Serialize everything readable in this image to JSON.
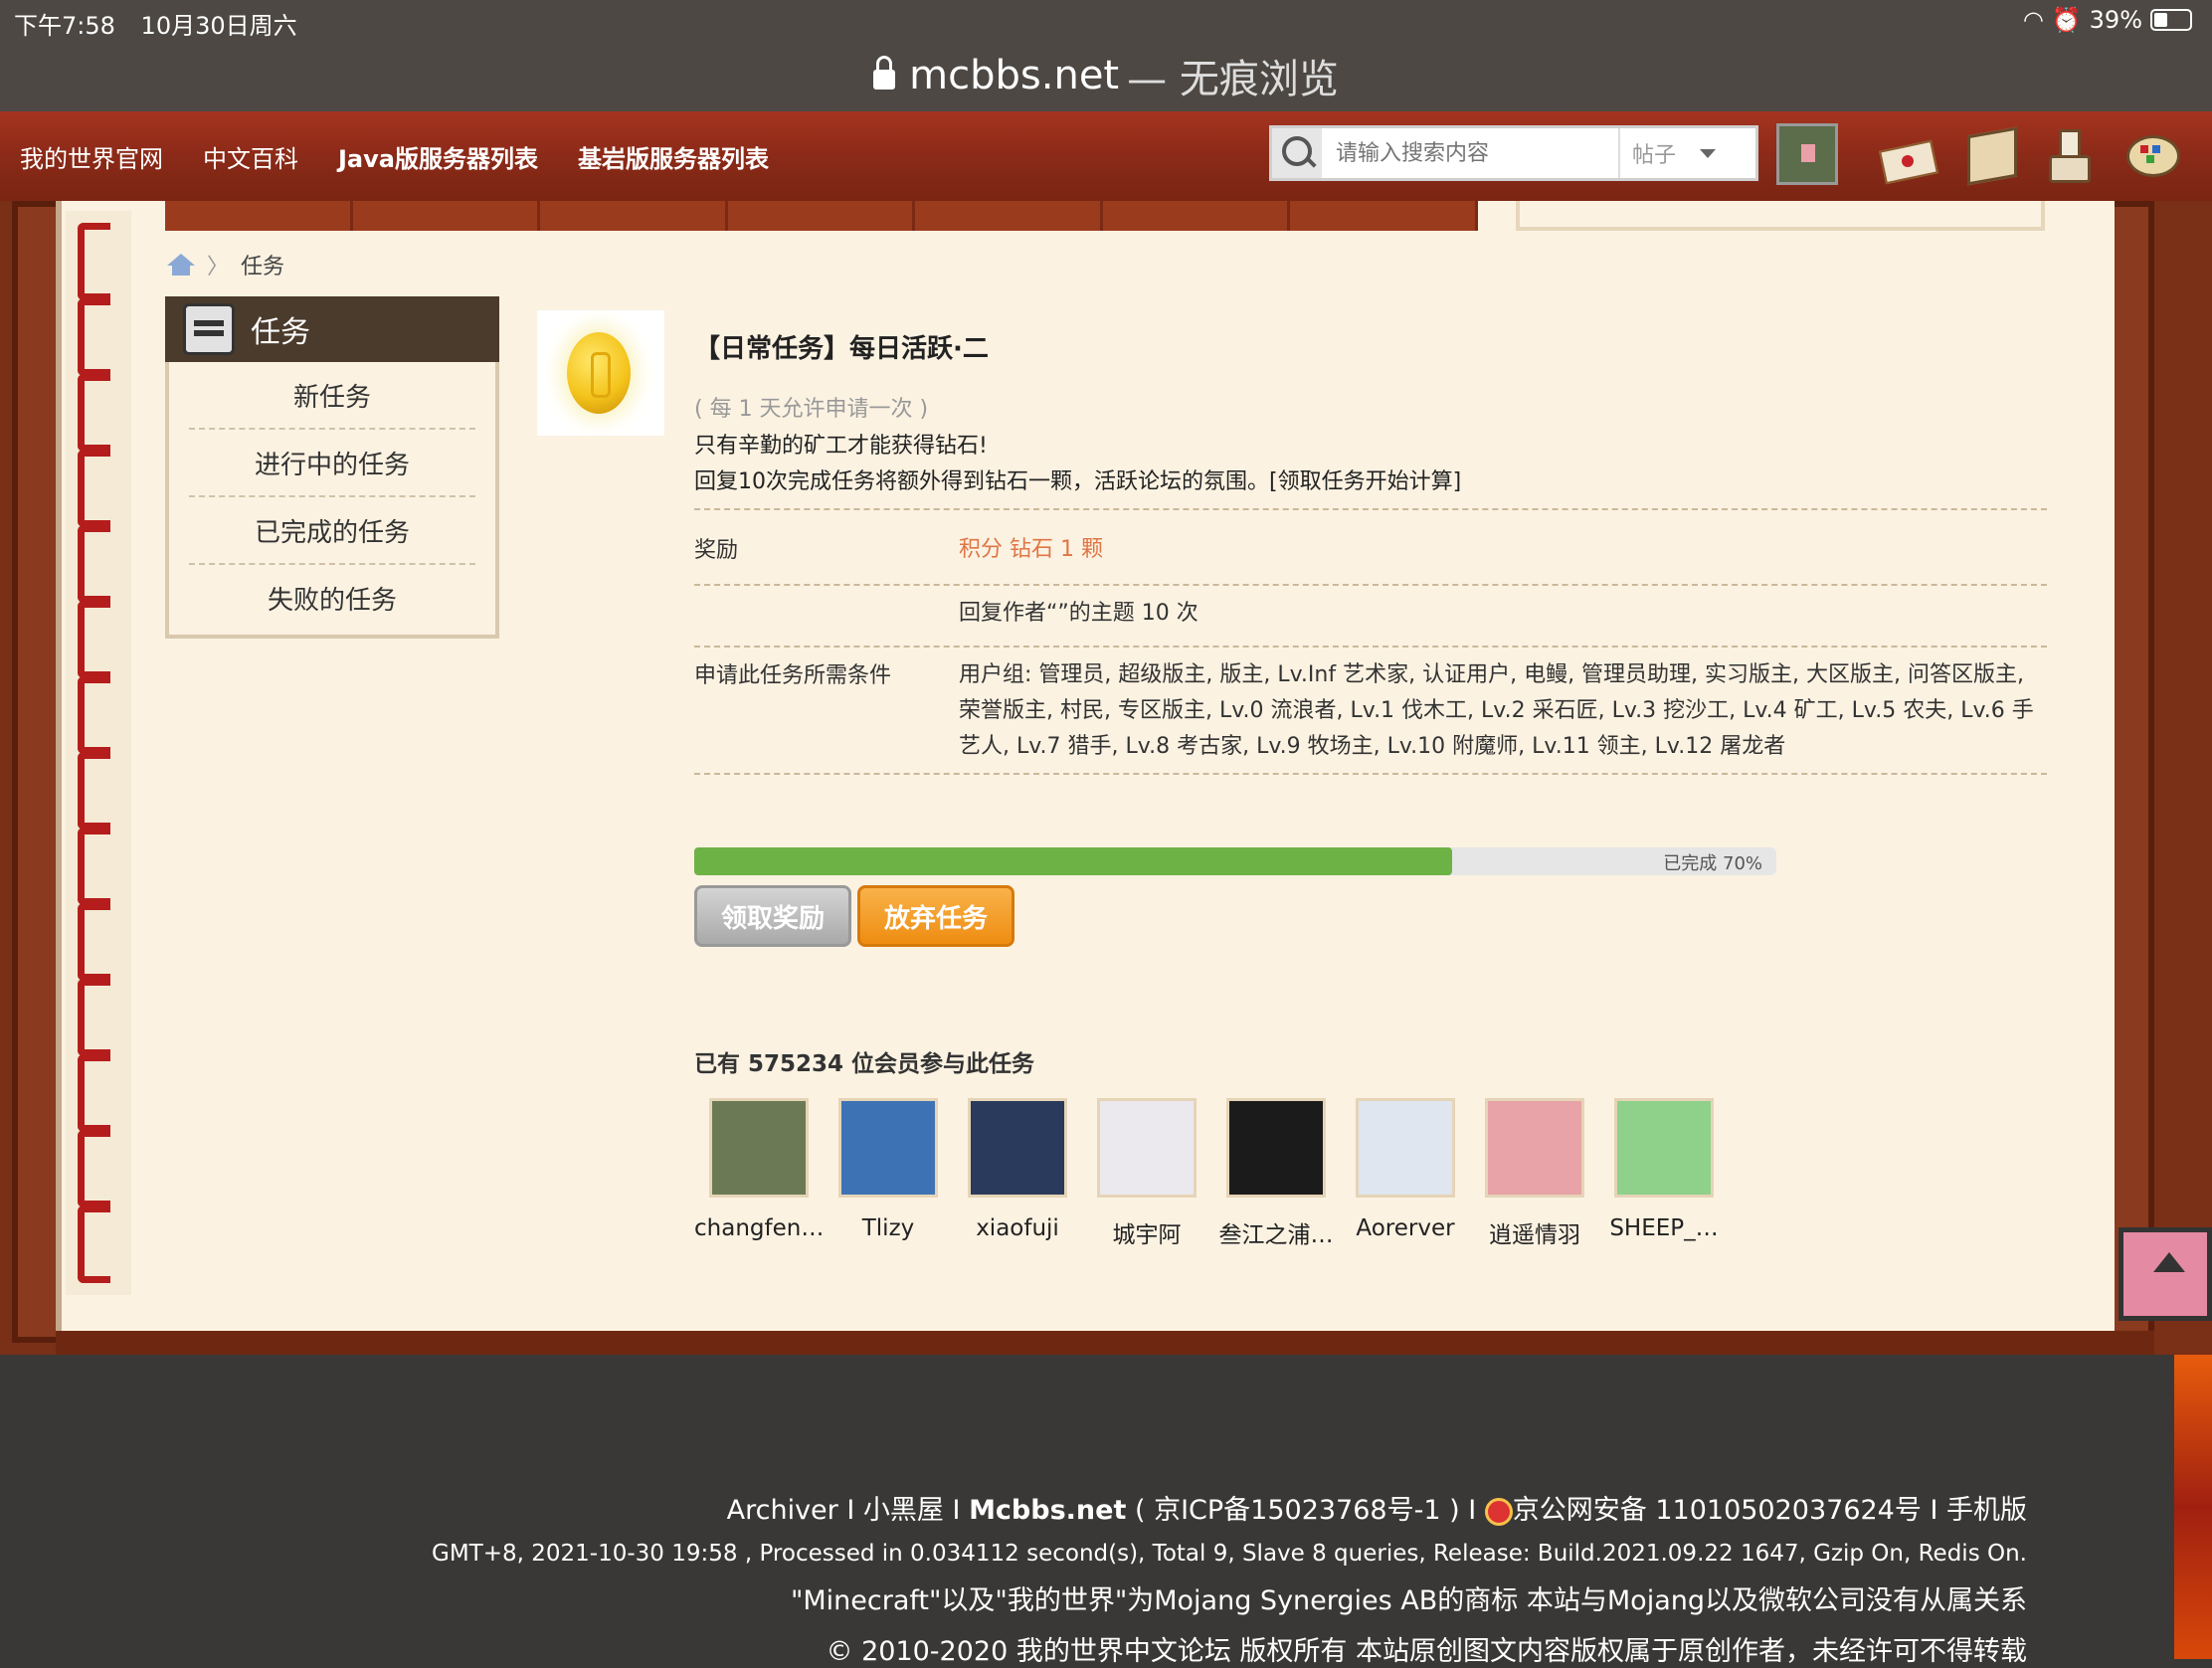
{
  "status": {
    "time": "下午7:58",
    "date": "10月30日周六",
    "battery": "39%",
    "battery_level": 0.39
  },
  "browser": {
    "domain": "mcbbs.net",
    "mode": "— 无痕浏览"
  },
  "nav": {
    "links": [
      "我的世界官网",
      "中文百科",
      "Java版服务器列表",
      "基岩版服务器列表"
    ],
    "search_placeholder": "请输入搜索内容",
    "search_type": "帖子",
    "icons": [
      "user-avatar",
      "mail-icon",
      "crate-icon",
      "potion-icon",
      "palette-icon"
    ]
  },
  "breadcrumb": {
    "current": "任务",
    "separator": "〉"
  },
  "sidebar": {
    "title": "任务",
    "items": [
      "新任务",
      "进行中的任务",
      "已完成的任务",
      "失败的任务"
    ]
  },
  "task": {
    "title": "【日常任务】每日活跃·二",
    "note": "( 每 1 天允许申请一次 )",
    "desc1": "只有辛勤的矿工才能获得钻石!",
    "desc2": "回复10次完成任务将额外得到钻石一颗，活跃论坛的氛围。[领取任务开始计算]",
    "reward_label": "奖励",
    "reward_value": "积分 钻石 1 颗",
    "requirement_text": "回复作者“”的主题 10 次",
    "conditions_label": "申请此任务所需条件",
    "conditions_value": "用户组: 管理员, 超级版主, 版主, Lv.Inf 艺术家, 认证用户, 电鳗, 管理员助理, 实习版主, 大区版主, 问答区版主, 荣誉版主, 村民, 专区版主, Lv.0 流浪者, Lv.1 伐木工, Lv.2 采石匠, Lv.3 挖沙工, Lv.4 矿工, Lv.5 农夫, Lv.6 手艺人, Lv.7 猎手, Lv.8 考古家, Lv.9 牧场主, Lv.10 附魔师, Lv.11 领主, Lv.12 屠龙者",
    "progress_percent": 70,
    "progress_text": "已完成 70%",
    "claim_label": "领取奖励",
    "abandon_label": "放弃任务",
    "members_title": "已有 575234 位会员参与此任务"
  },
  "members": [
    {
      "name": "changfen…",
      "color": "#6b7a55"
    },
    {
      "name": "Tlizy",
      "color": "#3d73b5"
    },
    {
      "name": "xiaofuji",
      "color": "#2a3a5c"
    },
    {
      "name": "城宇阿",
      "color": "#ebe8ee"
    },
    {
      "name": "叁江之浦…",
      "color": "#1b1b1b"
    },
    {
      "name": "Aorerver",
      "color": "#dfe6ef"
    },
    {
      "name": "逍遥情羽",
      "color": "#e8a3a8"
    },
    {
      "name": "SHEEP_…",
      "color": "#8fd08a"
    }
  ],
  "footer": {
    "archiver": "Archiver",
    "room": "小黑屋",
    "site": "Mcbbs.net",
    "icp": "( 京ICP备15023768号-1 )",
    "police": "京公网安备 11010502037624号",
    "mobile": "手机版",
    "stats": "GMT+8, 2021-10-30 19:58 , Processed in 0.034112 second(s), Total 9, Slave 8 queries, Release: Build.2021.09.22 1647, Gzip On, Redis On.",
    "trademark": "\"Minecraft\"以及\"我的世界\"为Mojang Synergies AB的商标 本站与Mojang以及微软公司没有从属关系",
    "copyright": "© 2010-2020 我的世界中文论坛 版权所有 本站原创图文内容版权属于原创作者，未经许可不得转载"
  }
}
